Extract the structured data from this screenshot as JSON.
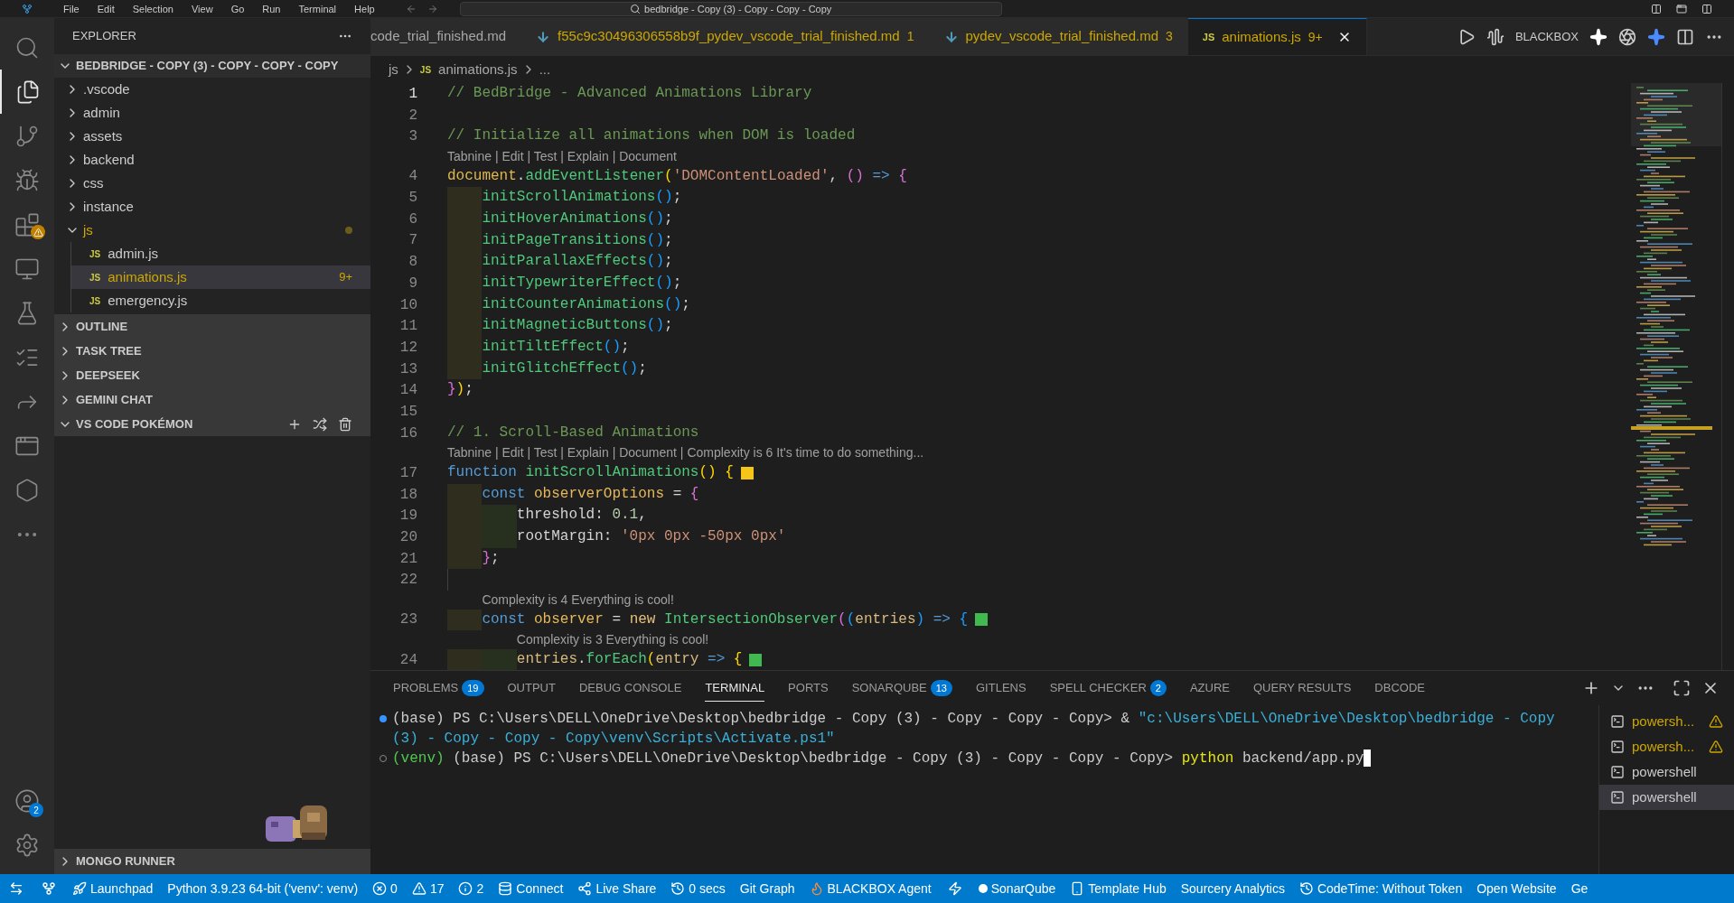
{
  "title_bar": {
    "menu": [
      "File",
      "Edit",
      "Selection",
      "View",
      "Go",
      "Run",
      "Terminal",
      "Help"
    ],
    "command_center": "bedbridge - Copy (3) - Copy - Copy - Copy"
  },
  "activity_bar": {
    "items": [
      {
        "kind": "search",
        "selected": false,
        "alert": false
      },
      {
        "kind": "explorer",
        "selected": true,
        "alert": false
      },
      {
        "kind": "source-control",
        "selected": false,
        "alert": false
      },
      {
        "kind": "debug",
        "selected": false,
        "alert": false
      },
      {
        "kind": "extensions",
        "selected": false,
        "alert": true
      },
      {
        "kind": "remote",
        "selected": false,
        "alert": false
      },
      {
        "kind": "testing",
        "selected": false,
        "alert": false
      },
      {
        "kind": "tasks",
        "selected": false,
        "alert": false
      },
      {
        "kind": "share",
        "selected": false,
        "alert": false
      },
      {
        "kind": "browser",
        "selected": false,
        "alert": false
      },
      {
        "kind": "cube",
        "selected": false,
        "alert": false
      },
      {
        "kind": "more",
        "selected": false,
        "alert": false
      }
    ],
    "account_badge": "2"
  },
  "sidebar": {
    "title": "EXPLORER",
    "root": {
      "label": "BEDBRIDGE - COPY (3) - COPY - COPY - COPY",
      "expanded": true,
      "children": [
        {
          "label": ".vscode",
          "kind": "folder",
          "expanded": false,
          "modified": false
        },
        {
          "label": "admin",
          "kind": "folder",
          "expanded": false,
          "modified": false
        },
        {
          "label": "assets",
          "kind": "folder",
          "expanded": false,
          "modified": false
        },
        {
          "label": "backend",
          "kind": "folder",
          "expanded": false,
          "modified": false
        },
        {
          "label": "css",
          "kind": "folder",
          "expanded": false,
          "modified": false
        },
        {
          "label": "instance",
          "kind": "folder",
          "expanded": false,
          "modified": false
        },
        {
          "label": "js",
          "kind": "folder",
          "expanded": true,
          "modified": true,
          "children": [
            {
              "label": "admin.js",
              "kind": "file",
              "icon_label": "JS",
              "selected": false
            },
            {
              "label": "animations.js",
              "kind": "file",
              "icon_label": "JS",
              "selected": true,
              "problems": "9+"
            },
            {
              "label": "emergency.js",
              "kind": "file",
              "icon_label": "JS",
              "selected": false
            }
          ]
        }
      ]
    },
    "sections": [
      {
        "label": "OUTLINE",
        "expanded": false
      },
      {
        "label": "TASK TREE",
        "expanded": false
      },
      {
        "label": "DEEPSEEK",
        "expanded": false
      },
      {
        "label": "GEMINI CHAT",
        "expanded": false
      },
      {
        "label": "VS CODE POKÉMON",
        "expanded": true
      }
    ],
    "bottom_section": {
      "label": "MONGO RUNNER",
      "expanded": false
    }
  },
  "tabs": [
    {
      "label": "code_trial_finished.md",
      "kind": "plain",
      "selected": false
    },
    {
      "label": "f55c9c30496306558b9f_pydev_vscode_trial_finished.md",
      "kind": "md",
      "problems": "1",
      "selected": false
    },
    {
      "label": "pydev_vscode_trial_finished.md",
      "kind": "md",
      "problems": "3",
      "selected": false
    },
    {
      "label": "animations.js",
      "kind": "js",
      "icon_label": "JS",
      "problems": "9+",
      "selected": true
    }
  ],
  "editor_actions": {
    "label": "BLACKBOX"
  },
  "breadcrumb": [
    {
      "label": "js"
    },
    {
      "label": "animations.js",
      "icon_label": "JS"
    },
    {
      "label": "..."
    }
  ],
  "code": [
    {
      "kind": "code",
      "number": "1",
      "current": true,
      "tokens": [
        {
          "kind": "comment",
          "text": "// BedBridge - Advanced Animations Library"
        }
      ]
    },
    {
      "kind": "code",
      "number": "2",
      "current": false
    },
    {
      "kind": "code",
      "number": "3",
      "current": false,
      "tokens": [
        {
          "kind": "comment",
          "text": "// Initialize all animations when DOM is loaded"
        }
      ]
    },
    {
      "kind": "lens",
      "text": "Tabnine | Edit | Test | Explain | Document"
    },
    {
      "kind": "code",
      "number": "4",
      "current": false,
      "tokens": [
        {
          "kind": "obj",
          "text": "document"
        },
        {
          "kind": "punct",
          "text": "."
        },
        {
          "kind": "fn",
          "text": "addEventListener"
        },
        {
          "kind": "b1",
          "text": "("
        },
        {
          "kind": "string",
          "text": "'DOMContentLoaded'"
        },
        {
          "kind": "punct",
          "text": ", "
        },
        {
          "kind": "b2",
          "text": "()"
        },
        {
          "kind": "kw",
          "text": " => "
        },
        {
          "kind": "b2",
          "text": "{"
        }
      ],
      "children": [
        {
          "kind": "code",
          "number": "5",
          "current": false,
          "tokens": [
            {
              "kind": "fn",
              "text": "initScrollAnimations"
            },
            {
              "kind": "b3",
              "text": "()"
            },
            {
              "kind": "punct",
              "text": ";"
            }
          ]
        },
        {
          "kind": "code",
          "number": "6",
          "current": false,
          "tokens": [
            {
              "kind": "fn",
              "text": "initHoverAnimations"
            },
            {
              "kind": "b3",
              "text": "()"
            },
            {
              "kind": "punct",
              "text": ";"
            }
          ]
        },
        {
          "kind": "code",
          "number": "7",
          "current": false,
          "tokens": [
            {
              "kind": "fn",
              "text": "initPageTransitions"
            },
            {
              "kind": "b3",
              "text": "()"
            },
            {
              "kind": "punct",
              "text": ";"
            }
          ]
        },
        {
          "kind": "code",
          "number": "8",
          "current": false,
          "tokens": [
            {
              "kind": "fn",
              "text": "initParallaxEffects"
            },
            {
              "kind": "b3",
              "text": "()"
            },
            {
              "kind": "punct",
              "text": ";"
            }
          ]
        },
        {
          "kind": "code",
          "number": "9",
          "current": false,
          "tokens": [
            {
              "kind": "fn",
              "text": "initTypewriterEffect"
            },
            {
              "kind": "b3",
              "text": "()"
            },
            {
              "kind": "punct",
              "text": ";"
            }
          ]
        },
        {
          "kind": "code",
          "number": "10",
          "current": false,
          "tokens": [
            {
              "kind": "fn",
              "text": "initCounterAnimations"
            },
            {
              "kind": "b3",
              "text": "()"
            },
            {
              "kind": "punct",
              "text": ";"
            }
          ]
        },
        {
          "kind": "code",
          "number": "11",
          "current": false,
          "tokens": [
            {
              "kind": "fn",
              "text": "initMagneticButtons"
            },
            {
              "kind": "b3",
              "text": "()"
            },
            {
              "kind": "punct",
              "text": ";"
            }
          ]
        },
        {
          "kind": "code",
          "number": "12",
          "current": false,
          "tokens": [
            {
              "kind": "fn",
              "text": "initTiltEffect"
            },
            {
              "kind": "b3",
              "text": "()"
            },
            {
              "kind": "punct",
              "text": ";"
            }
          ]
        },
        {
          "kind": "code",
          "number": "13",
          "current": false,
          "tokens": [
            {
              "kind": "fn",
              "text": "initGlitchEffect"
            },
            {
              "kind": "b3",
              "text": "()"
            },
            {
              "kind": "punct",
              "text": ";"
            }
          ]
        }
      ]
    },
    {
      "kind": "code",
      "number": "14",
      "current": false,
      "tokens": [
        {
          "kind": "b2",
          "text": "}"
        },
        {
          "kind": "b1",
          "text": ")"
        },
        {
          "kind": "punct",
          "text": ";"
        }
      ]
    },
    {
      "kind": "code",
      "number": "15",
      "current": false
    },
    {
      "kind": "code",
      "number": "16",
      "current": false,
      "tokens": [
        {
          "kind": "comment",
          "text": "// 1. Scroll-Based Animations"
        }
      ]
    },
    {
      "kind": "lens",
      "text": "Tabnine | Edit | Test | Explain | Document | Complexity is 6 It's time to do something..."
    },
    {
      "kind": "code",
      "number": "17",
      "current": false,
      "tokens": [
        {
          "kind": "kw",
          "text": "function "
        },
        {
          "kind": "fn",
          "text": "initScrollAnimations"
        },
        {
          "kind": "b1",
          "text": "() {"
        },
        {
          "kind": "mark",
          "color": "#f5c518"
        }
      ],
      "children": [
        {
          "kind": "code",
          "number": "18",
          "current": false,
          "tokens": [
            {
              "kind": "kw",
              "text": "const "
            },
            {
              "kind": "var",
              "text": "observerOptions"
            },
            {
              "kind": "punct",
              "text": " = "
            },
            {
              "kind": "b2",
              "text": "{"
            }
          ],
          "children": [
            {
              "kind": "code",
              "number": "19",
              "current": false,
              "tokens": [
                {
                  "kind": "prop",
                  "text": "threshold"
                },
                {
                  "kind": "punct",
                  "text": ": "
                },
                {
                  "kind": "num",
                  "text": "0.1"
                },
                {
                  "kind": "punct",
                  "text": ","
                }
              ]
            },
            {
              "kind": "code",
              "number": "20",
              "current": false,
              "tokens": [
                {
                  "kind": "prop",
                  "text": "rootMargin"
                },
                {
                  "kind": "punct",
                  "text": ": "
                },
                {
                  "kind": "string",
                  "text": "'0px 0px -50px 0px'"
                }
              ]
            }
          ]
        },
        {
          "kind": "code",
          "number": "21",
          "current": false,
          "tokens": [
            {
              "kind": "b2",
              "text": "}"
            },
            {
              "kind": "punct",
              "text": ";"
            }
          ]
        },
        {
          "kind": "code",
          "number": "22",
          "current": false
        },
        {
          "kind": "lens",
          "text": "Complexity is 4 Everything is cool!"
        },
        {
          "kind": "code",
          "number": "23",
          "current": false,
          "tokens": [
            {
              "kind": "kw",
              "text": "const "
            },
            {
              "kind": "var",
              "text": "observer"
            },
            {
              "kind": "punct",
              "text": " = "
            },
            {
              "kind": "new",
              "text": "new "
            },
            {
              "kind": "fn",
              "text": "IntersectionObserver"
            },
            {
              "kind": "b2",
              "text": "("
            },
            {
              "kind": "b3",
              "text": "("
            },
            {
              "kind": "param",
              "text": "entries"
            },
            {
              "kind": "b3",
              "text": ")"
            },
            {
              "kind": "kw",
              "text": " => "
            },
            {
              "kind": "b3",
              "text": "{"
            },
            {
              "kind": "mark",
              "color": "#3fb950"
            }
          ],
          "children": [
            {
              "kind": "lens",
              "text": "Complexity is 3 Everything is cool!"
            },
            {
              "kind": "code",
              "number": "24",
              "current": false,
              "tokens": [
                {
                  "kind": "param",
                  "text": "entries"
                },
                {
                  "kind": "punct",
                  "text": "."
                },
                {
                  "kind": "fn",
                  "text": "forEach"
                },
                {
                  "kind": "b1",
                  "text": "("
                },
                {
                  "kind": "param",
                  "text": "entry"
                },
                {
                  "kind": "kw",
                  "text": " => "
                },
                {
                  "kind": "b1",
                  "text": "{"
                },
                {
                  "kind": "mark",
                  "color": "#3fb950"
                }
              ]
            }
          ]
        }
      ]
    }
  ],
  "panel": {
    "tabs": [
      {
        "label": "PROBLEMS",
        "count": "19",
        "selected": false
      },
      {
        "label": "OUTPUT",
        "selected": false
      },
      {
        "label": "DEBUG CONSOLE",
        "selected": false
      },
      {
        "label": "TERMINAL",
        "selected": true
      },
      {
        "label": "PORTS",
        "selected": false
      },
      {
        "label": "SONARQUBE",
        "count": "13",
        "selected": false
      },
      {
        "label": "GITLENS",
        "selected": false
      },
      {
        "label": "SPELL CHECKER",
        "count": "2",
        "selected": false
      },
      {
        "label": "AZURE",
        "selected": false
      },
      {
        "label": "QUERY RESULTS",
        "selected": false
      },
      {
        "label": "DBCODE",
        "selected": false
      }
    ],
    "terminal": [
      {
        "kind": "success",
        "parts": [
          {
            "kind": "plain",
            "text": "(base) PS C:\\Users\\DELL\\OneDrive\\Desktop\\bedbridge - Copy (3) - Copy - Copy - Copy> & "
          },
          {
            "kind": "string",
            "text": "\"c:\\Users\\DELL\\OneDrive\\Desktop\\bedbridge - Copy (3) - Copy - Copy - Copy\\venv\\Scripts\\Activate.ps1\""
          }
        ]
      },
      {
        "kind": "pending",
        "parts": [
          {
            "kind": "env",
            "text": "(venv)"
          },
          {
            "kind": "plain",
            "text": " (base) PS C:\\Users\\DELL\\OneDrive\\Desktop\\bedbridge - Copy (3) - Copy - Copy - Copy> "
          },
          {
            "kind": "command",
            "text": "python"
          },
          {
            "kind": "plain",
            "text": " backend/app.py"
          }
        ],
        "cursor": true
      }
    ],
    "terminals": [
      {
        "label": "powersh...",
        "warning": true,
        "selected": false
      },
      {
        "label": "powersh...",
        "warning": true,
        "selected": false
      },
      {
        "label": "powershell",
        "warning": false,
        "selected": false
      },
      {
        "label": "powershell",
        "warning": false,
        "selected": true
      }
    ]
  },
  "status_bar": [
    {
      "kind": "remote"
    },
    {
      "kind": "graph"
    },
    {
      "kind": "rocket",
      "text": "Launchpad"
    },
    {
      "kind": "text",
      "text": "Python 3.9.23 64-bit ('venv': venv)"
    },
    {
      "kind": "error",
      "text": "0"
    },
    {
      "kind": "warning",
      "text": "17"
    },
    {
      "kind": "info",
      "text": "2"
    },
    {
      "kind": "database",
      "text": "Connect"
    },
    {
      "kind": "share",
      "text": "Live Share"
    },
    {
      "kind": "history",
      "text": "0 secs"
    },
    {
      "kind": "text",
      "text": "Git Graph"
    },
    {
      "kind": "flame",
      "text": "BLACKBOX Agent"
    },
    {
      "kind": "bolt"
    },
    {
      "kind": "dot",
      "text": "SonarQube"
    },
    {
      "kind": "device",
      "text": "Template Hub"
    },
    {
      "kind": "text",
      "text": "Sourcery Analytics"
    },
    {
      "kind": "history",
      "text": "CodeTime: Without Token"
    },
    {
      "kind": "text",
      "text": "Open Website"
    },
    {
      "kind": "text",
      "text": "Ge"
    }
  ]
}
